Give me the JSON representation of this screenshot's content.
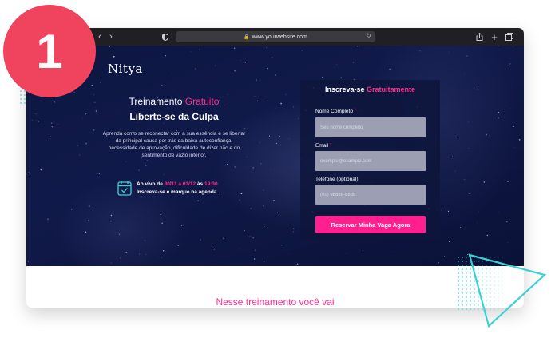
{
  "step_badge": "1",
  "browser": {
    "url": "www.yourwebsite.com",
    "nav_back": "‹",
    "nav_forward": "›"
  },
  "hero": {
    "logo": "Nitya",
    "title_prefix": "Treinamento",
    "title_highlight": "Gratuito",
    "subtitle": "Liberte-se da Culpa",
    "description": "Aprenda como se reconectar com a sua essência e se libertar da principal causa por trás da baixa autoconfiança, necessidade de aprovação, dificuldade de dizer não e do sentimento de vazio interior.",
    "live": {
      "prefix": "Ao vivo de",
      "dates": "30/11 a 03/12",
      "at": "às",
      "time": "19:30",
      "line2": "Inscreva-se e marque na agenda."
    }
  },
  "form": {
    "title_prefix": "Inscreva-se",
    "title_highlight": "Gratuitamente",
    "name_label": "Nome Completo",
    "name_placeholder": "Seu nome completo",
    "email_label": "Email",
    "email_placeholder": "exemple@example.com",
    "phone_label": "Telefone (optional)",
    "phone_placeholder": "(00) 98888-8888",
    "required_mark": "*",
    "submit_label": "Reservar Minha Vaga Agora"
  },
  "lower": {
    "title": "Nesse treinamento você vai"
  },
  "colors": {
    "accent": "#ff2d8f",
    "badge": "#f0435e",
    "hero_bg": "#101a4a",
    "deco": "#3ad1d4"
  },
  "icons": [
    "chevron-left-icon",
    "chevron-right-icon",
    "shield-icon",
    "lock-icon",
    "reload-icon",
    "share-icon",
    "plus-icon",
    "tabs-icon",
    "calendar-check-icon"
  ]
}
